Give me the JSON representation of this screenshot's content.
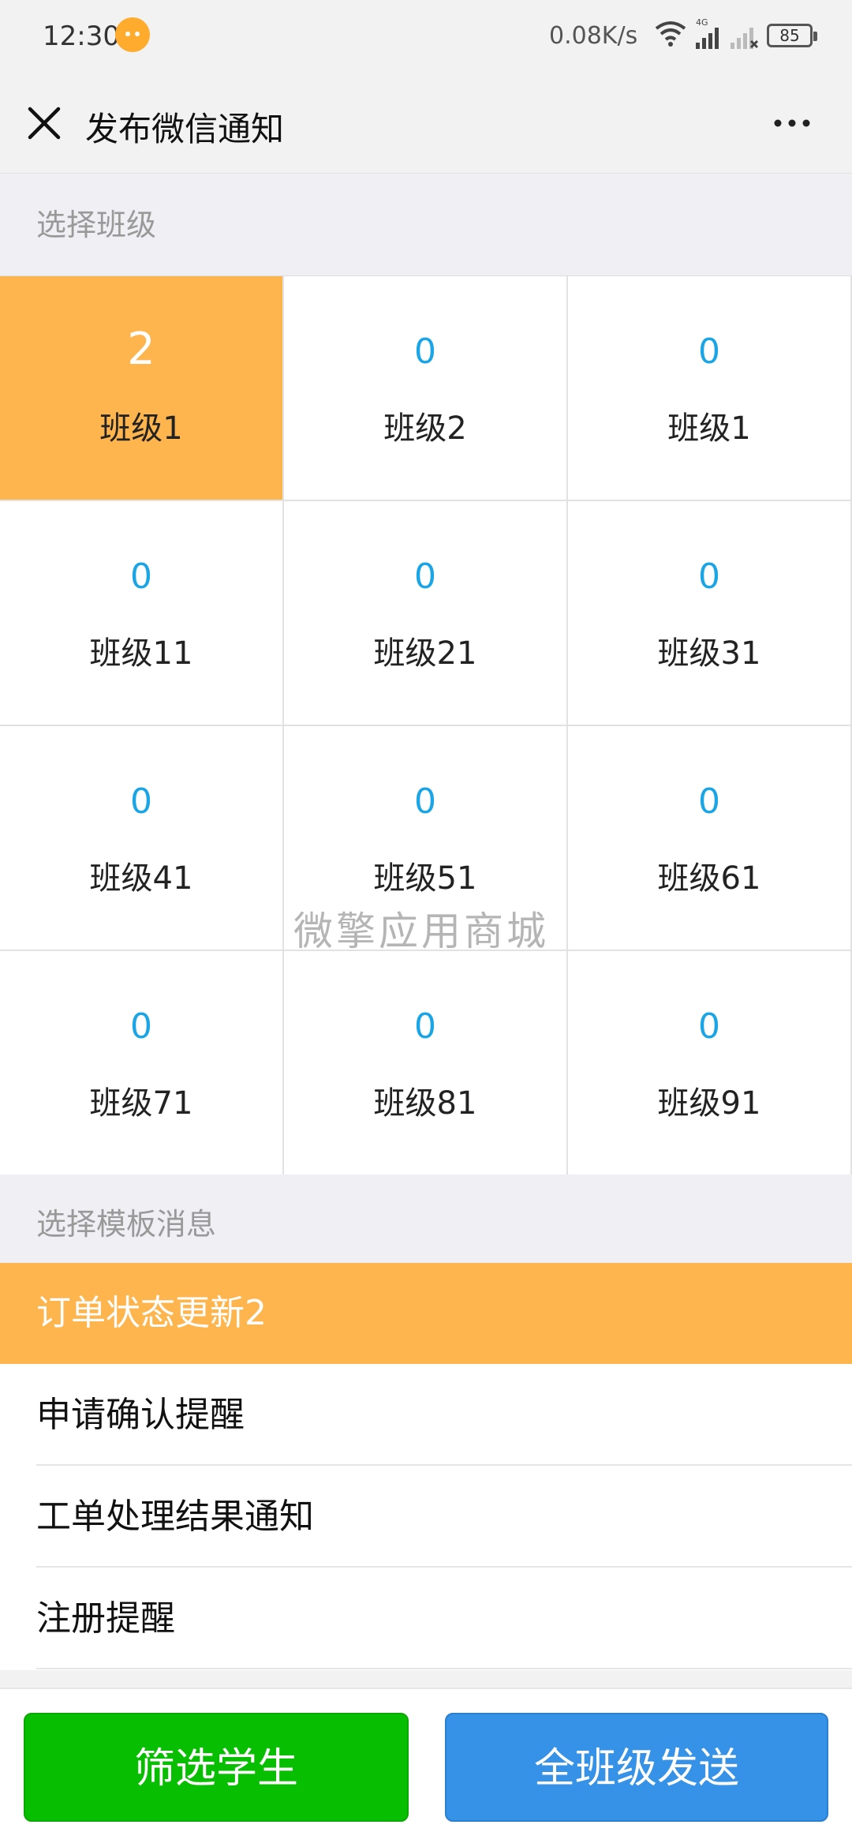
{
  "status_bar": {
    "time": "12:30",
    "net_speed": "0.08K/s",
    "network_type": "4G",
    "battery": "85",
    "icons": [
      "message-icon",
      "wifi-icon",
      "signal-icon",
      "signal-off-icon",
      "battery-icon"
    ]
  },
  "nav": {
    "title": "发布微信通知",
    "close_icon": "close-icon",
    "more_icon": "more-icon"
  },
  "sections": {
    "class_header": "选择班级",
    "template_header": "选择模板消息"
  },
  "classes": [
    {
      "count": "2",
      "name": "班级1",
      "selected": true
    },
    {
      "count": "0",
      "name": "班级2"
    },
    {
      "count": "0",
      "name": "班级1"
    },
    {
      "count": "0",
      "name": "班级11"
    },
    {
      "count": "0",
      "name": "班级21"
    },
    {
      "count": "0",
      "name": "班级31"
    },
    {
      "count": "0",
      "name": "班级41"
    },
    {
      "count": "0",
      "name": "班级51"
    },
    {
      "count": "0",
      "name": "班级61"
    },
    {
      "count": "0",
      "name": "班级71"
    },
    {
      "count": "0",
      "name": "班级81"
    },
    {
      "count": "0",
      "name": "班级91"
    }
  ],
  "watermark": "微擎应用商城",
  "templates": [
    {
      "label": "订单状态更新2",
      "selected": true
    },
    {
      "label": "申请确认提醒"
    },
    {
      "label": "工单处理结果通知"
    },
    {
      "label": "注册提醒"
    }
  ],
  "footer": {
    "filter_label": "筛选学生",
    "send_label": "全班级发送"
  },
  "colors": {
    "selected_bg": "#ffb54d",
    "count_blue": "#1aa6e6",
    "filter_green": "#08be00",
    "send_blue": "#3592e6",
    "badge_orange": "#ffab2e"
  }
}
